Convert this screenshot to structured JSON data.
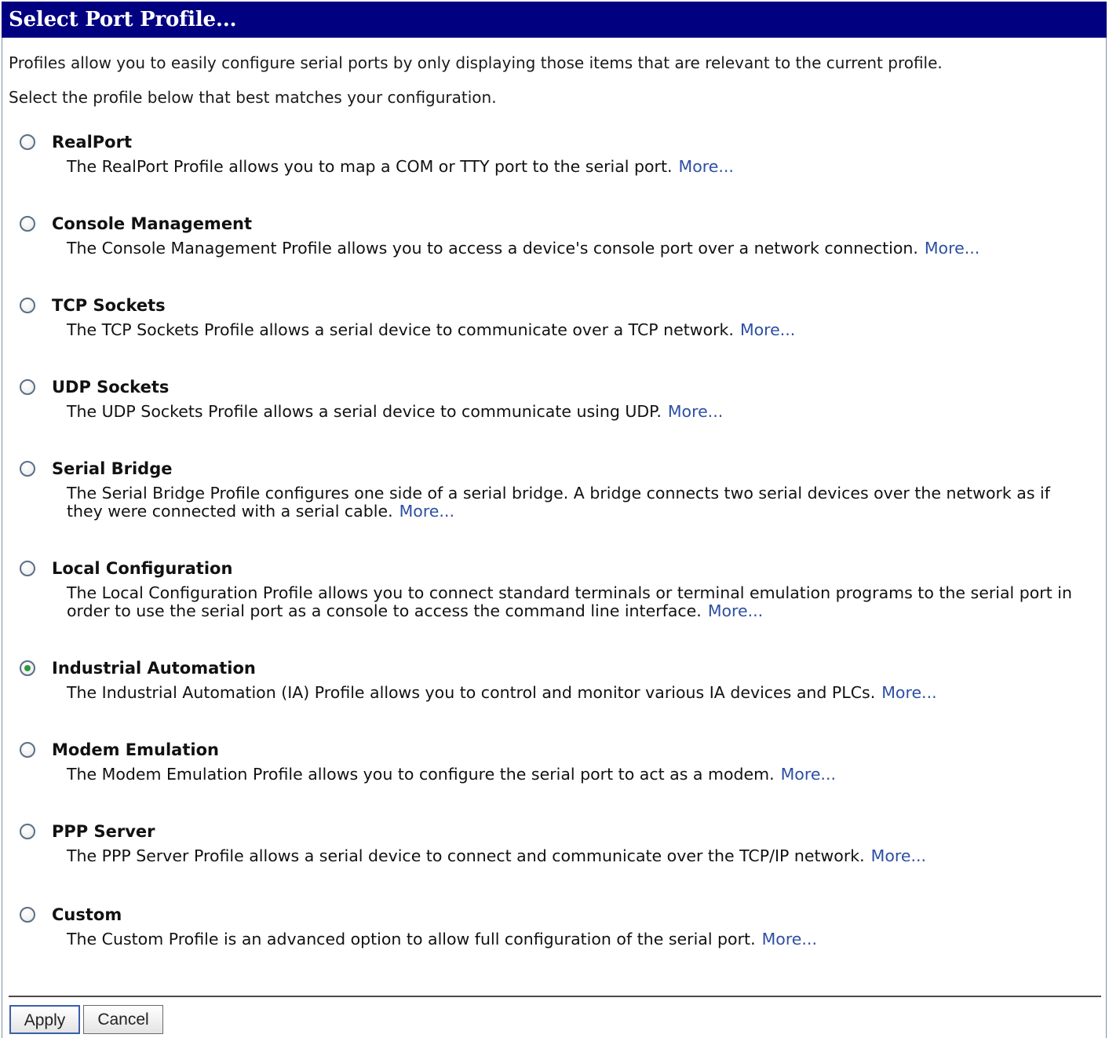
{
  "title": "Select Port Profile...",
  "intro": {
    "line1": "Profiles allow you to easily configure serial ports by only displaying those items that are relevant to the current profile.",
    "line2": "Select the profile below that best matches your configuration."
  },
  "more_label": "More...",
  "selected_profile": "Industrial Automation",
  "profiles": [
    {
      "name": "RealPort",
      "description": "The RealPort Profile allows you to map a COM or TTY port to the serial port.",
      "more": "More...",
      "checked": false
    },
    {
      "name": "Console Management",
      "description": "The Console Management Profile allows you to access a device's console port over a network connection.",
      "more": "More...",
      "checked": false
    },
    {
      "name": "TCP Sockets",
      "description": "The TCP Sockets Profile allows a serial device to communicate over a TCP network.",
      "more": "More...",
      "checked": false
    },
    {
      "name": "UDP Sockets",
      "description": "The UDP Sockets Profile allows a serial device to communicate using UDP.",
      "more": "More...",
      "checked": false
    },
    {
      "name": "Serial Bridge",
      "description": "The Serial Bridge Profile configures one side of a serial bridge. A bridge connects two serial devices over the network as if they were connected with a serial cable.",
      "more": "More...",
      "checked": false
    },
    {
      "name": "Local Configuration",
      "description": "The Local Configuration Profile allows you to connect standard terminals or terminal emulation programs to the serial port in order to use the serial port as a console to access the command line interface.",
      "more": "More...",
      "checked": false
    },
    {
      "name": "Industrial Automation",
      "description": "The Industrial Automation (IA) Profile allows you to control and monitor various IA devices and PLCs.",
      "more": "More...",
      "checked": true
    },
    {
      "name": "Modem Emulation",
      "description": "The Modem Emulation Profile allows you to configure the serial port to act as a modem.",
      "more": "More...",
      "checked": false
    },
    {
      "name": "PPP Server",
      "description": "The PPP Server Profile allows a serial device to connect and communicate over the TCP/IP network.",
      "more": "More...",
      "checked": false
    },
    {
      "name": "Custom",
      "description": "The Custom Profile is an advanced option to allow full configuration of the serial port.",
      "more": "More...",
      "checked": false
    }
  ],
  "buttons": {
    "apply": "Apply",
    "cancel": "Cancel"
  },
  "colors": {
    "title_bar": "#000080",
    "link": "#2c4fa3",
    "radio_selected": "#2e9a3c"
  }
}
